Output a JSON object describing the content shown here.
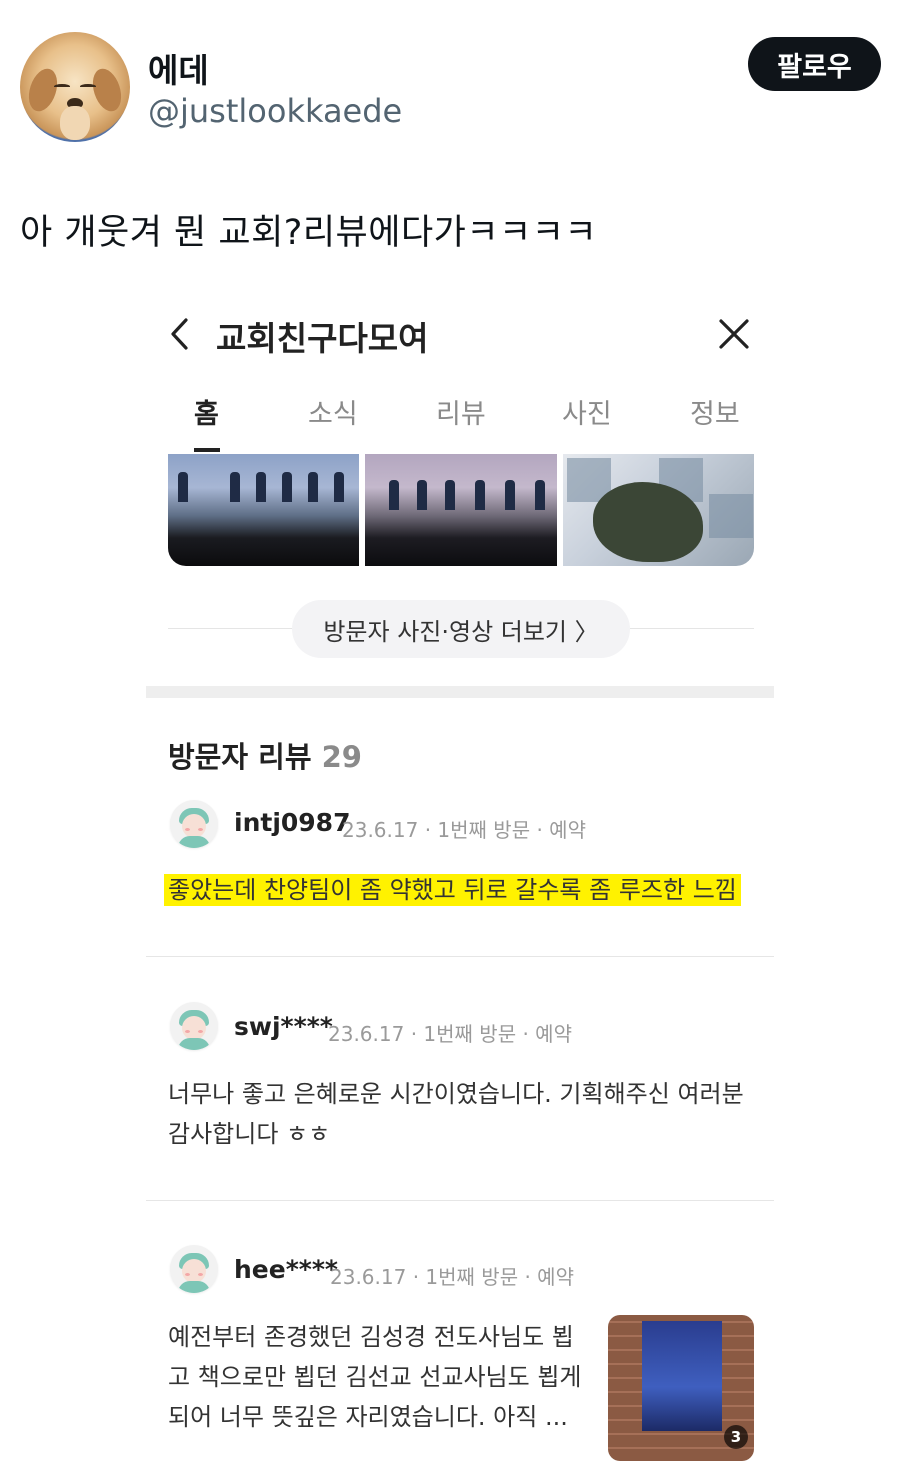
{
  "tweet": {
    "display_name": "에데",
    "handle": "@justlookkaede",
    "follow_label": "팔로우",
    "text": "아 개웃겨 뭔 교회?리뷰에다가ㅋㅋㅋㅋ"
  },
  "screenshot": {
    "title": "교회친구다모여",
    "tabs": [
      "홈",
      "소식",
      "리뷰",
      "사진",
      "정보"
    ],
    "active_tab": "홈",
    "more_button": "방문자 사진·영상 더보기 〉",
    "reviews_header": {
      "label": "방문자 리뷰",
      "count": "29"
    },
    "reviews": [
      {
        "user": "intj0987",
        "meta": "23.6.17 · 1번째 방문 · 예약",
        "text": "좋았는데 찬양팀이 좀 약했고 뒤로 갈수록 좀 루즈한 느낌",
        "highlighted": true
      },
      {
        "user": "swj****",
        "meta": "23.6.17 · 1번째 방문 · 예약",
        "text_line1": "너무나 좋고 은혜로운 시간이였습니다. 기획해주신 여러분",
        "text_line2": "감사합니다 ㅎㅎ"
      },
      {
        "user": "hee****",
        "meta": "23.6.17 · 1번째 방문 · 예약",
        "text_line1": "예전부터 존경했던 김성경 전도사님도 뵙",
        "text_line2": "고 책으로만 뵙던 김선교 선교사님도 뵙게",
        "text_line3": "되어 너무 뜻깊은 자리였습니다. 아직 ...",
        "photo_count": "3"
      }
    ]
  },
  "colors": {
    "follow_bg": "#0f1419",
    "handle": "#536471",
    "highlight": "#fff200",
    "avatar_accent": "#7dc6b6"
  },
  "icons": [
    "back-chevron-icon",
    "close-icon"
  ]
}
